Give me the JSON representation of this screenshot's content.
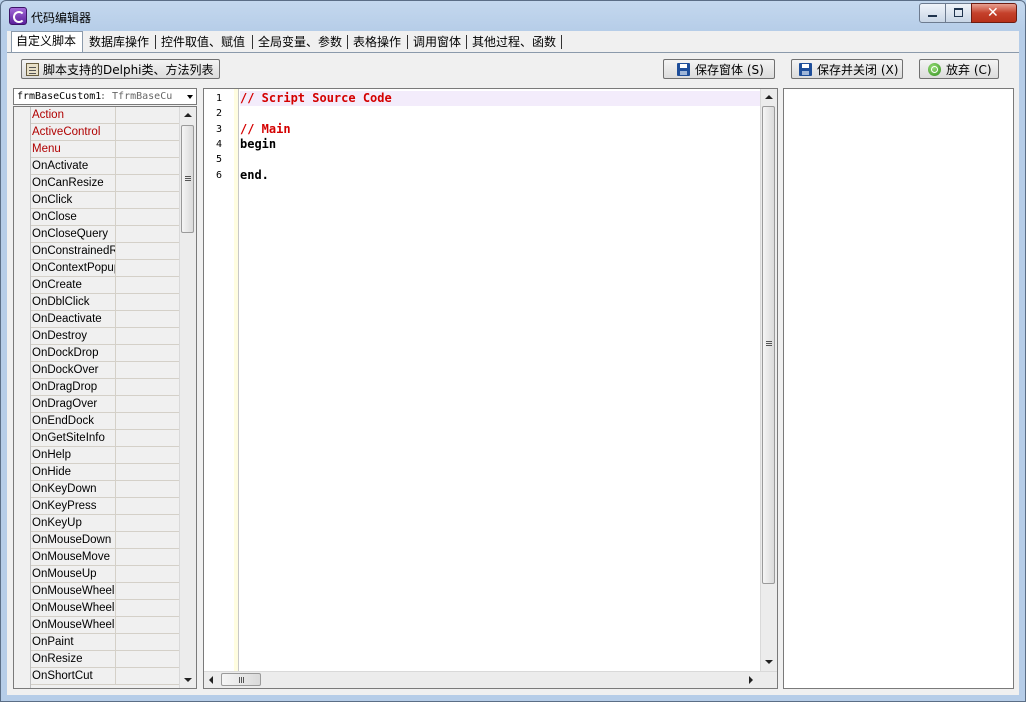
{
  "window": {
    "title": "代码编辑器"
  },
  "tabs": [
    {
      "label": "自定义脚本",
      "active": true
    },
    {
      "label": "数据库操作",
      "active": false
    },
    {
      "label": "控件取值、赋值",
      "active": false
    },
    {
      "label": "全局变量、参数",
      "active": false
    },
    {
      "label": "表格操作",
      "active": false
    },
    {
      "label": "调用窗体",
      "active": false
    },
    {
      "label": "其他过程、函数",
      "active": false
    }
  ],
  "toolbar": {
    "class_list_label": "脚本支持的Delphi类、方法列表",
    "save_form_label": "保存窗体 (S)",
    "save_close_label": "保存并关闭 (X)",
    "discard_label": "放弃 (C)"
  },
  "object_selector": {
    "object_name": "frmBaseCustom1",
    "object_type": ": TfrmBaseCu"
  },
  "inspector": {
    "properties": [
      {
        "name": "Action",
        "highlight": true
      },
      {
        "name": "ActiveControl",
        "highlight": true
      },
      {
        "name": "Menu",
        "highlight": true
      },
      {
        "name": "OnActivate",
        "highlight": false
      },
      {
        "name": "OnCanResize",
        "highlight": false
      },
      {
        "name": "OnClick",
        "highlight": false
      },
      {
        "name": "OnClose",
        "highlight": false
      },
      {
        "name": "OnCloseQuery",
        "highlight": false
      },
      {
        "name": "OnConstrainedRe",
        "highlight": false
      },
      {
        "name": "OnContextPopup",
        "highlight": false
      },
      {
        "name": "OnCreate",
        "highlight": false
      },
      {
        "name": "OnDblClick",
        "highlight": false
      },
      {
        "name": "OnDeactivate",
        "highlight": false
      },
      {
        "name": "OnDestroy",
        "highlight": false
      },
      {
        "name": "OnDockDrop",
        "highlight": false
      },
      {
        "name": "OnDockOver",
        "highlight": false
      },
      {
        "name": "OnDragDrop",
        "highlight": false
      },
      {
        "name": "OnDragOver",
        "highlight": false
      },
      {
        "name": "OnEndDock",
        "highlight": false
      },
      {
        "name": "OnGetSiteInfo",
        "highlight": false
      },
      {
        "name": "OnHelp",
        "highlight": false
      },
      {
        "name": "OnHide",
        "highlight": false
      },
      {
        "name": "OnKeyDown",
        "highlight": false
      },
      {
        "name": "OnKeyPress",
        "highlight": false
      },
      {
        "name": "OnKeyUp",
        "highlight": false
      },
      {
        "name": "OnMouseDown",
        "highlight": false
      },
      {
        "name": "OnMouseMove",
        "highlight": false
      },
      {
        "name": "OnMouseUp",
        "highlight": false
      },
      {
        "name": "OnMouseWheel",
        "highlight": false
      },
      {
        "name": "OnMouseWheelD",
        "highlight": false
      },
      {
        "name": "OnMouseWheelU",
        "highlight": false
      },
      {
        "name": "OnPaint",
        "highlight": false
      },
      {
        "name": "OnResize",
        "highlight": false
      },
      {
        "name": "OnShortCut",
        "highlight": false
      }
    ]
  },
  "editor": {
    "lines": [
      {
        "num": "1",
        "text": "// Script Source Code",
        "kind": "comment",
        "current": true
      },
      {
        "num": "2",
        "text": "",
        "kind": "code",
        "current": false
      },
      {
        "num": "3",
        "text": "// Main",
        "kind": "comment",
        "current": false
      },
      {
        "num": "4",
        "text": "begin",
        "kind": "code",
        "current": false
      },
      {
        "num": "5",
        "text": "",
        "kind": "code",
        "current": false
      },
      {
        "num": "6",
        "text": "end.",
        "kind": "code",
        "current": false
      }
    ]
  },
  "colors": {
    "comment": "#d40000",
    "highlight_property": "#b00000"
  }
}
